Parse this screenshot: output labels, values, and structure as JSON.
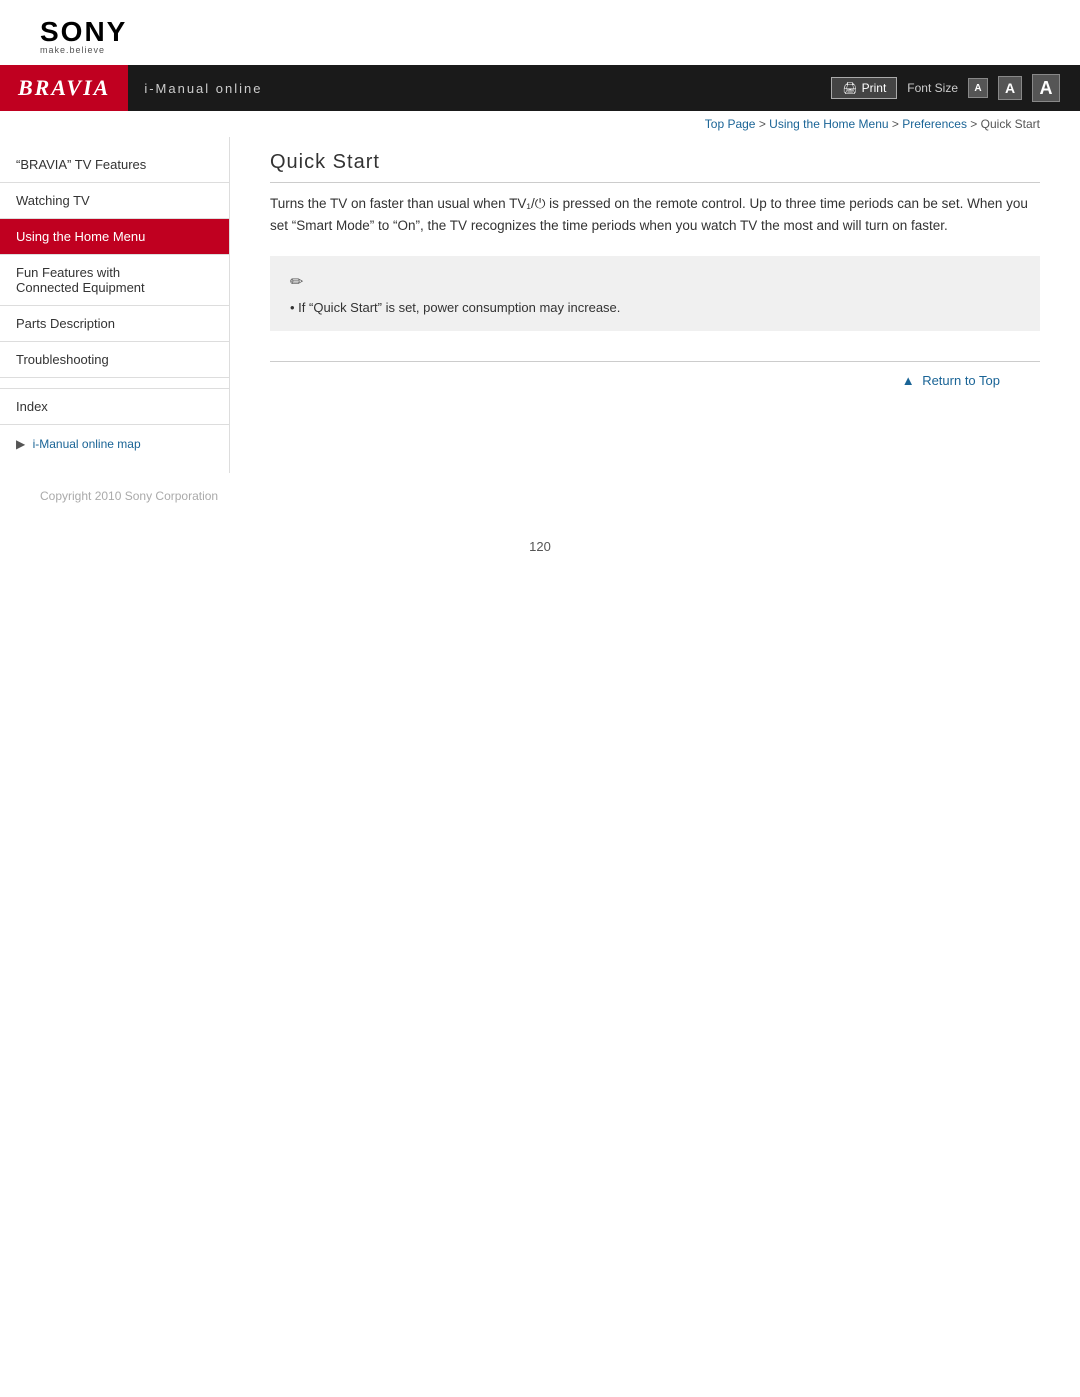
{
  "logo": {
    "sony": "SONY",
    "tagline": "make.believe"
  },
  "banner": {
    "bravia": "BRAVIA",
    "manual_title": "i-Manual online",
    "print_label": "Print",
    "font_size_label": "Font Size",
    "font_btn_sm": "A",
    "font_btn_md": "A",
    "font_btn_lg": "A"
  },
  "breadcrumb": {
    "top_page": "Top Page",
    "sep1": " > ",
    "home_menu": "Using the Home Menu",
    "sep2": " > ",
    "preferences": "Preferences",
    "sep3": " > ",
    "current": "Quick Start"
  },
  "sidebar": {
    "items": [
      {
        "label": "\"BRAVIA\" TV Features",
        "active": false
      },
      {
        "label": "Watching TV",
        "active": false
      },
      {
        "label": "Using the Home Menu",
        "active": true
      },
      {
        "label": "Fun Features with\nConnected Equipment",
        "active": false
      },
      {
        "label": "Parts Description",
        "active": false
      },
      {
        "label": "Troubleshooting",
        "active": false
      }
    ],
    "index_label": "Index",
    "map_arrow": "▶",
    "map_link": "i-Manual online map"
  },
  "content": {
    "page_title": "Quick Start",
    "body_text": "Turns the TV on faster than usual when TV₁/⏻ is pressed on the remote control. Up to three time periods can be set. When you set “Smart Mode” to “On”, the TV recognizes the time periods when you watch TV the most and will turn on faster.",
    "note_icon": "✏",
    "note_bullet": "If “Quick Start” is set, power consumption may increase."
  },
  "return_top": {
    "arrow": "▲",
    "label": "Return to Top"
  },
  "footer": {
    "copyright": "Copyright 2010 Sony Corporation"
  },
  "page_number": "120"
}
